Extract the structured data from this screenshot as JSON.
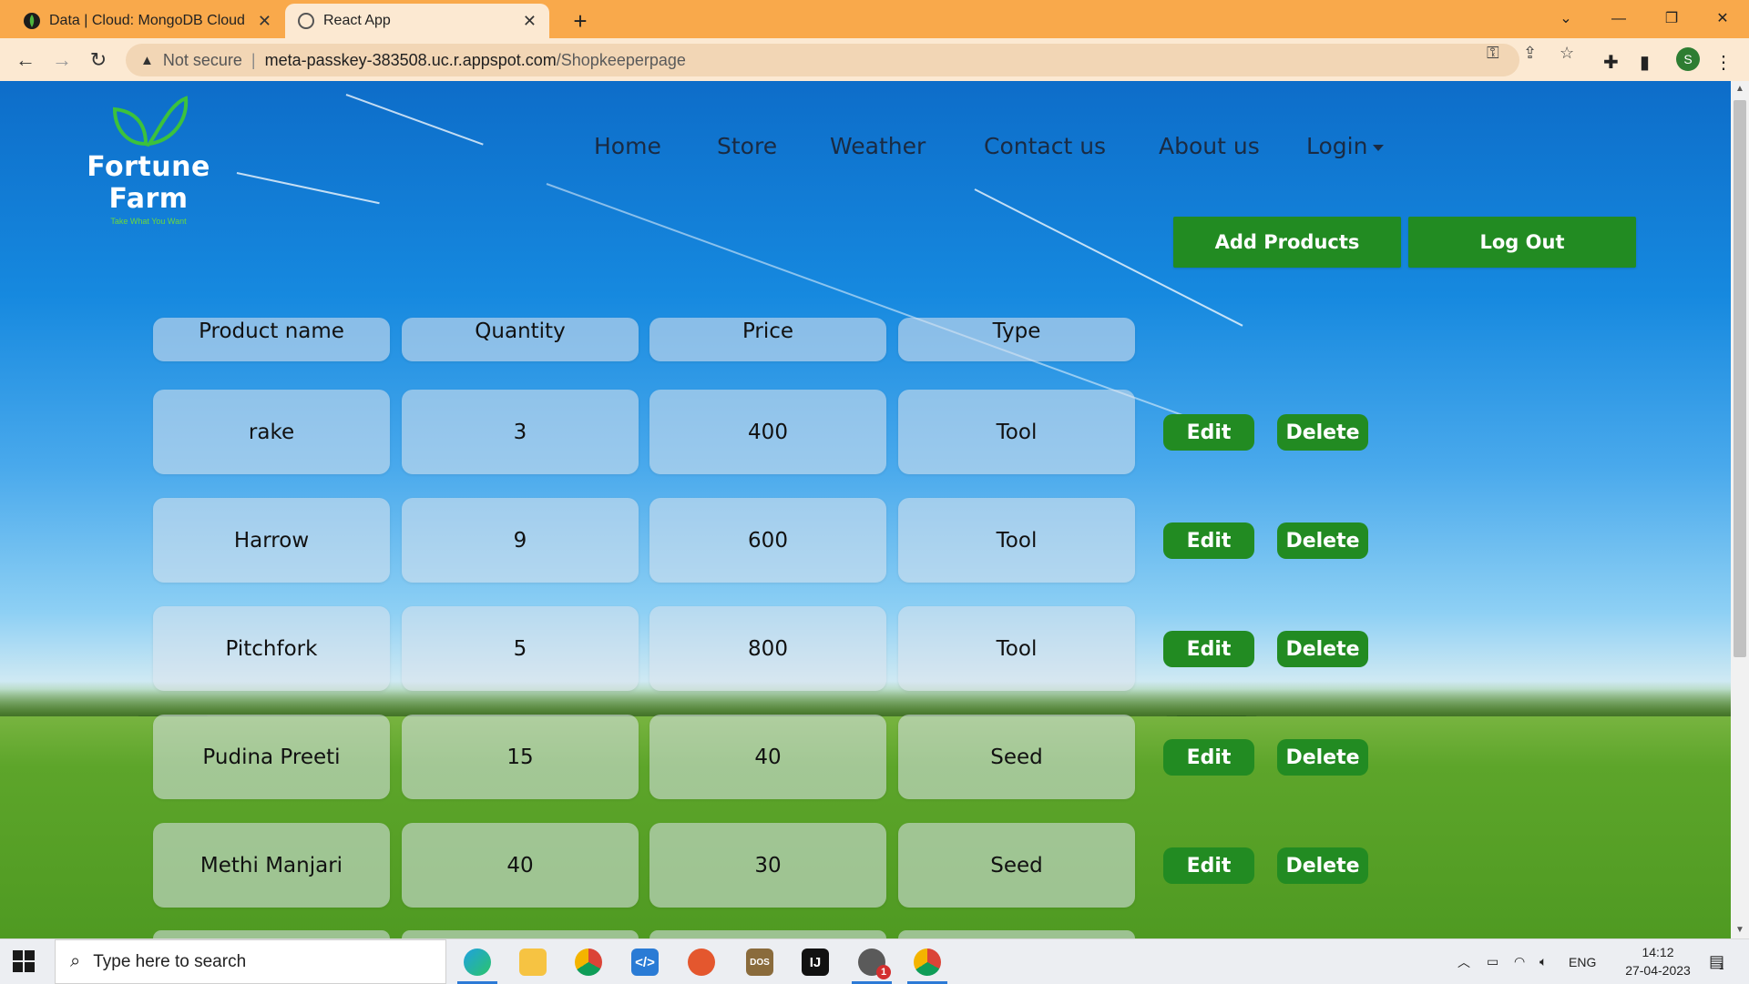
{
  "browser": {
    "tabs": [
      {
        "title": "Data | Cloud: MongoDB Cloud",
        "active": false,
        "favicon": "mongodb-leaf-icon"
      },
      {
        "title": "React App",
        "active": true,
        "favicon": "globe-icon"
      }
    ],
    "new_tab": "+",
    "security_label": "Not secure",
    "url_host": "meta-passkey-383508.uc.r.appspot.com",
    "url_path": "/Shopkeeperpage",
    "profile_initial": "S"
  },
  "site": {
    "brand": "Fortune Farm",
    "tagline": "Take What You Want",
    "nav": [
      "Home",
      "Store",
      "Weather",
      "Contact us",
      "About us",
      "Login"
    ],
    "actions": {
      "add": "Add Products",
      "logout": "Log Out"
    }
  },
  "table": {
    "headers": [
      "Product name",
      "Quantity",
      "Price",
      "Type"
    ],
    "rows": [
      {
        "name": "rake",
        "quantity": "3",
        "price": "400",
        "type": "Tool"
      },
      {
        "name": "Harrow",
        "quantity": "9",
        "price": "600",
        "type": "Tool"
      },
      {
        "name": "Pitchfork",
        "quantity": "5",
        "price": "800",
        "type": "Tool"
      },
      {
        "name": "Pudina Preeti",
        "quantity": "15",
        "price": "40",
        "type": "Seed"
      },
      {
        "name": "Methi Manjari",
        "quantity": "40",
        "price": "30",
        "type": "Seed"
      }
    ],
    "row_actions": {
      "edit": "Edit",
      "delete": "Delete"
    }
  },
  "taskbar": {
    "search_placeholder": "Type here to search",
    "language": "ENG",
    "time": "14:12",
    "date": "27-04-2023",
    "notification_count": "1",
    "badge_count": "1"
  },
  "colors": {
    "brand_green": "#228b22",
    "chrome_orange": "#f9a94b",
    "nav_text": "#1a2b43"
  }
}
